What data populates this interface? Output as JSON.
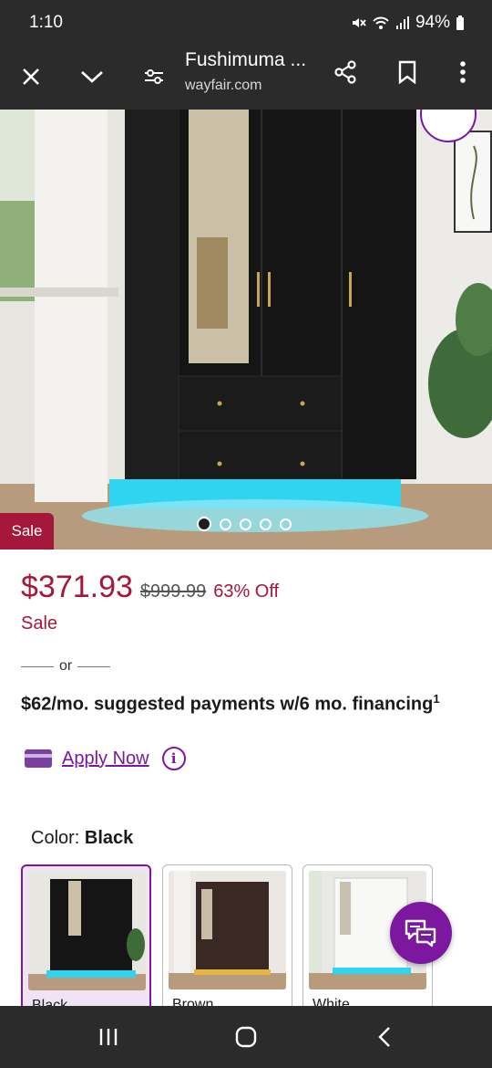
{
  "status": {
    "time": "1:10",
    "battery": "94%",
    "icons": [
      "mute-icon",
      "wifi-icon",
      "signal-icon",
      "battery-icon"
    ]
  },
  "toolbar": {
    "title": "Fushimuma ...",
    "url": "wayfair.com",
    "icons": [
      "close-icon",
      "chevron-down-icon",
      "site-settings-icon",
      "share-icon",
      "bookmark-icon",
      "more-icon"
    ]
  },
  "hero": {
    "sale_badge": "Sale",
    "carousel_count": 5,
    "carousel_active": 0
  },
  "price": {
    "current": "$371.93",
    "original": "$999.99",
    "discount": "63% Off",
    "sale_label": "Sale"
  },
  "financing": {
    "or_text": "or",
    "line": "$62/mo. suggested payments w/6 mo. financing",
    "footnote": "1",
    "apply_label": "Apply Now",
    "info_glyph": "i"
  },
  "color": {
    "label": "Color:",
    "selected": "Black",
    "options": [
      {
        "name": "Black"
      },
      {
        "name": "Brown"
      },
      {
        "name": "White"
      }
    ]
  },
  "colors": {
    "brand_purple": "#7b189f",
    "sale_red": "#a5173b",
    "bar_bg": "#2b2b2b"
  }
}
